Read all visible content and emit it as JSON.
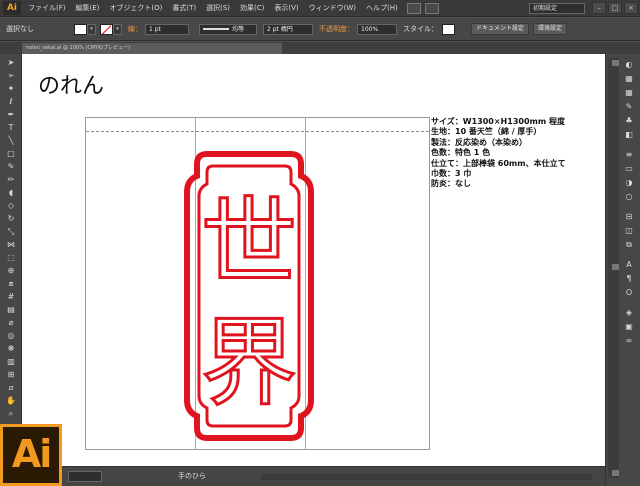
{
  "app": {
    "logo": "Ai"
  },
  "menu": [
    "ファイル(F)",
    "編集(E)",
    "オブジェクト(O)",
    "書式(T)",
    "選択(S)",
    "効果(C)",
    "表示(V)",
    "ウィンドウ(W)",
    "ヘルプ(H)"
  ],
  "workspace": "初期設定",
  "control": {
    "selection": "選択なし",
    "stroke_label": "線：",
    "stroke_weight": "1 pt",
    "stroke_style": "均等",
    "brush": "2 pt 楕円",
    "opacity_label": "不透明度：",
    "opacity": "100%",
    "style_label": "スタイル：",
    "doc_setup": "ドキュメント設定",
    "prefs": "環境設定"
  },
  "doc_tab": "nolen_sekai.ai @ 100% (CMYK/プレビュー)",
  "document": {
    "title": "のれん",
    "specs": [
      "サイズ：W1300×H1300mm 程度",
      "生地：10 番天竺（綿 / 厚手）",
      "製法：反応染め（本染め）",
      "色数：特色 1 色",
      "仕立て：上部棒袋 60mm、本仕立て",
      "巾数：3 巾",
      "防炎：なし"
    ],
    "stamp_glyphs": [
      "世",
      "界"
    ],
    "stamp_color": "#e0141e"
  },
  "status": {
    "zoom": "",
    "tool": "手のひら"
  },
  "icons": {
    "tools": [
      "selection-icon",
      "direct-selection-icon",
      "magic-wand-icon",
      "lasso-icon",
      "pen-icon",
      "type-icon",
      "line-icon",
      "rectangle-icon",
      "paintbrush-icon",
      "pencil-icon",
      "blob-brush-icon",
      "eraser-icon",
      "rotate-icon",
      "scale-icon",
      "width-icon",
      "free-transform-icon",
      "shape-builder-icon",
      "perspective-icon",
      "mesh-icon",
      "gradient-icon",
      "eyedropper-icon",
      "blend-icon",
      "symbol-sprayer-icon",
      "graph-icon",
      "artboard-icon",
      "slice-icon",
      "hand-icon",
      "zoom-icon"
    ],
    "panels": [
      "color-icon",
      "color-guide-icon",
      "swatches-icon",
      "brushes-icon",
      "symbols-icon",
      "graphic-styles-icon",
      "stroke-icon",
      "gradient-panel-icon",
      "transparency-icon",
      "appearance-icon",
      "align-icon",
      "pathfinder-icon",
      "transform-icon",
      "character-icon",
      "paragraph-icon",
      "opentype-icon",
      "layers-icon",
      "artboards-panel-icon",
      "links-icon"
    ]
  }
}
